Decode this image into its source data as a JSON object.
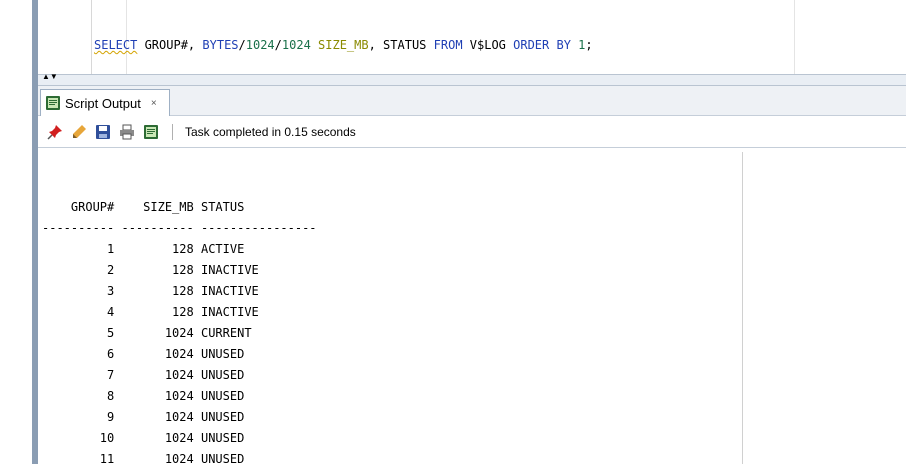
{
  "editor": {
    "sql_tokens": [
      {
        "t": "SELECT",
        "c": "kw squiggle"
      },
      {
        "t": " GROUP#, ",
        "c": ""
      },
      {
        "t": "BYTES",
        "c": "kw"
      },
      {
        "t": "/",
        "c": ""
      },
      {
        "t": "1024",
        "c": "num"
      },
      {
        "t": "/",
        "c": ""
      },
      {
        "t": "1024",
        "c": "num"
      },
      {
        "t": " ",
        "c": ""
      },
      {
        "t": "SIZE_MB",
        "c": "alias"
      },
      {
        "t": ", STATUS ",
        "c": ""
      },
      {
        "t": "FROM",
        "c": "kw"
      },
      {
        "t": " V$LOG ",
        "c": ""
      },
      {
        "t": "ORDER BY",
        "c": "kw"
      },
      {
        "t": " ",
        "c": ""
      },
      {
        "t": "1",
        "c": "num"
      },
      {
        "t": ";",
        "c": ""
      }
    ]
  },
  "output_tab": {
    "label": "Script Output",
    "close": "×"
  },
  "toolbar": {
    "icons": [
      "pin-icon",
      "eraser-icon",
      "save-icon",
      "print-icon",
      "output-file-icon"
    ],
    "status": "Task completed in 0.15 seconds"
  },
  "result": {
    "headers": [
      "GROUP#",
      "SIZE_MB",
      "STATUS"
    ],
    "rows": [
      [
        "1",
        "128",
        "ACTIVE"
      ],
      [
        "2",
        "128",
        "INACTIVE"
      ],
      [
        "3",
        "128",
        "INACTIVE"
      ],
      [
        "4",
        "128",
        "INACTIVE"
      ],
      [
        "5",
        "1024",
        "CURRENT"
      ],
      [
        "6",
        "1024",
        "UNUSED"
      ],
      [
        "7",
        "1024",
        "UNUSED"
      ],
      [
        "8",
        "1024",
        "UNUSED"
      ],
      [
        "9",
        "1024",
        "UNUSED"
      ],
      [
        "10",
        "1024",
        "UNUSED"
      ],
      [
        "11",
        "1024",
        "UNUSED"
      ]
    ]
  }
}
